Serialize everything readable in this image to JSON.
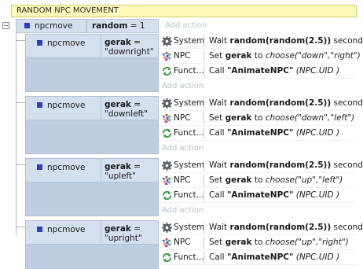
{
  "group": {
    "title": "RANDOM NPC MOVEMENT",
    "collapse_glyph": "−"
  },
  "top_event": {
    "object": "npcmove",
    "var": "random",
    "op": " = 1",
    "add_action": "Add action"
  },
  "sub_events": [
    {
      "object": "npcmove",
      "var": "gerak",
      "op": " =",
      "value": "\"downright\"",
      "actions": [
        {
          "icon": "gear-icon",
          "obj": "System",
          "pre": "Wait ",
          "bold": "random(random(2.5))",
          "post": " seconds",
          "pre2": "",
          "ital": ""
        },
        {
          "icon": "npc-sprite-icon",
          "obj": "NPC",
          "pre": "Set ",
          "bold": "gerak",
          "post": " to ",
          "ital": "choose(\"down\",\"right\")"
        },
        {
          "icon": "function-icon",
          "obj": "Funct...",
          "pre": "Call ",
          "bold": "\"AnimateNPC\"",
          "post": " ",
          "ital": "(NPC.UID )"
        }
      ],
      "add_action": "Add action"
    },
    {
      "object": "npcmove",
      "var": "gerak",
      "op": " =",
      "value": "\"downleft\"",
      "actions": [
        {
          "icon": "gear-icon",
          "obj": "System",
          "pre": "Wait ",
          "bold": "random(random(2.5))",
          "post": " seconds",
          "ital": ""
        },
        {
          "icon": "npc-sprite-icon",
          "obj": "NPC",
          "pre": "Set ",
          "bold": "gerak",
          "post": " to ",
          "ital": "choose(\"down\",\"left\")"
        },
        {
          "icon": "function-icon",
          "obj": "Funct...",
          "pre": "Call ",
          "bold": "\"AnimateNPC\"",
          "post": " ",
          "ital": "(NPC.UID )"
        }
      ],
      "add_action": "Add action"
    },
    {
      "object": "npcmove",
      "var": "gerak",
      "op": " =",
      "value": "\"upleft\"",
      "actions": [
        {
          "icon": "gear-icon",
          "obj": "System",
          "pre": "Wait ",
          "bold": "random(random(2.5))",
          "post": " seconds",
          "ital": ""
        },
        {
          "icon": "npc-sprite-icon",
          "obj": "NPC",
          "pre": "Set ",
          "bold": "gerak",
          "post": " to ",
          "ital": "choose(\"up\",\"left\")"
        },
        {
          "icon": "function-icon",
          "obj": "Funct...",
          "pre": "Call ",
          "bold": "\"AnimateNPC\"",
          "post": " ",
          "ital": "(NPC.UID )"
        }
      ],
      "add_action": "Add action"
    },
    {
      "object": "npcmove",
      "var": "gerak",
      "op": " =",
      "value": "\"upright\"",
      "actions": [
        {
          "icon": "gear-icon",
          "obj": "System",
          "pre": "Wait ",
          "bold": "random(random(2.5))",
          "post": " seconds",
          "ital": ""
        },
        {
          "icon": "npc-sprite-icon",
          "obj": "NPC",
          "pre": "Set ",
          "bold": "gerak",
          "post": " to ",
          "ital": "choose(\"up\",\"right\")"
        },
        {
          "icon": "function-icon",
          "obj": "Funct...",
          "pre": "Call ",
          "bold": "\"AnimateNPC\"",
          "post": " ",
          "ital": "(NPC.UID )"
        }
      ],
      "add_action": ""
    }
  ],
  "colors": {
    "group_bg": "#fff8b8",
    "condition_bg": "#d5e0ee",
    "condition_fill": "#bfcde0",
    "bullet": "#2b3fbf",
    "add_action_text": "#b5bfcc"
  }
}
